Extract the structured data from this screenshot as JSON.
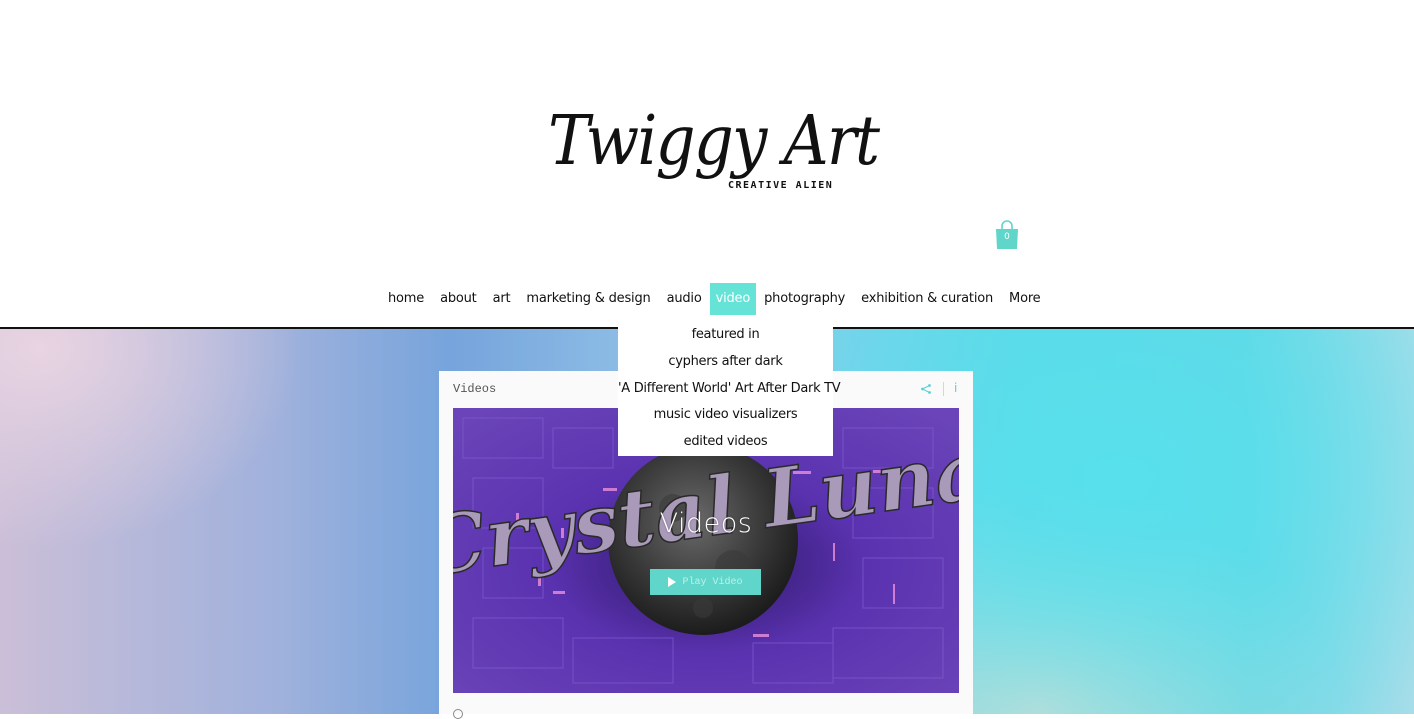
{
  "brand": {
    "logo_script": "Twiggy Art",
    "logo_tagline": "CREATIVE ALIEN"
  },
  "cart": {
    "count": "0",
    "icon": "shopping-bag-icon",
    "color": "#5fd6c9"
  },
  "nav": {
    "accent_color": "#66e3d7",
    "active": "video",
    "items": [
      {
        "label": "home"
      },
      {
        "label": "about"
      },
      {
        "label": "art"
      },
      {
        "label": "marketing & design"
      },
      {
        "label": "audio"
      },
      {
        "label": "video"
      },
      {
        "label": "photography"
      },
      {
        "label": "exhibition & curation"
      },
      {
        "label": "More"
      }
    ]
  },
  "dropdown": {
    "items": [
      {
        "label": "featured in"
      },
      {
        "label": "cyphers after dark"
      },
      {
        "label": "'A Different World' Art After Dark TV"
      },
      {
        "label": "music video visualizers"
      },
      {
        "label": "edited videos"
      }
    ]
  },
  "gallery": {
    "title": "Videos",
    "share_icon": "share-icon",
    "info_icon": "info-icon",
    "info_label": "i",
    "video": {
      "thumbnail_text": "Crystal Luna",
      "caption": "Videos",
      "play_label": "Play Video"
    }
  }
}
